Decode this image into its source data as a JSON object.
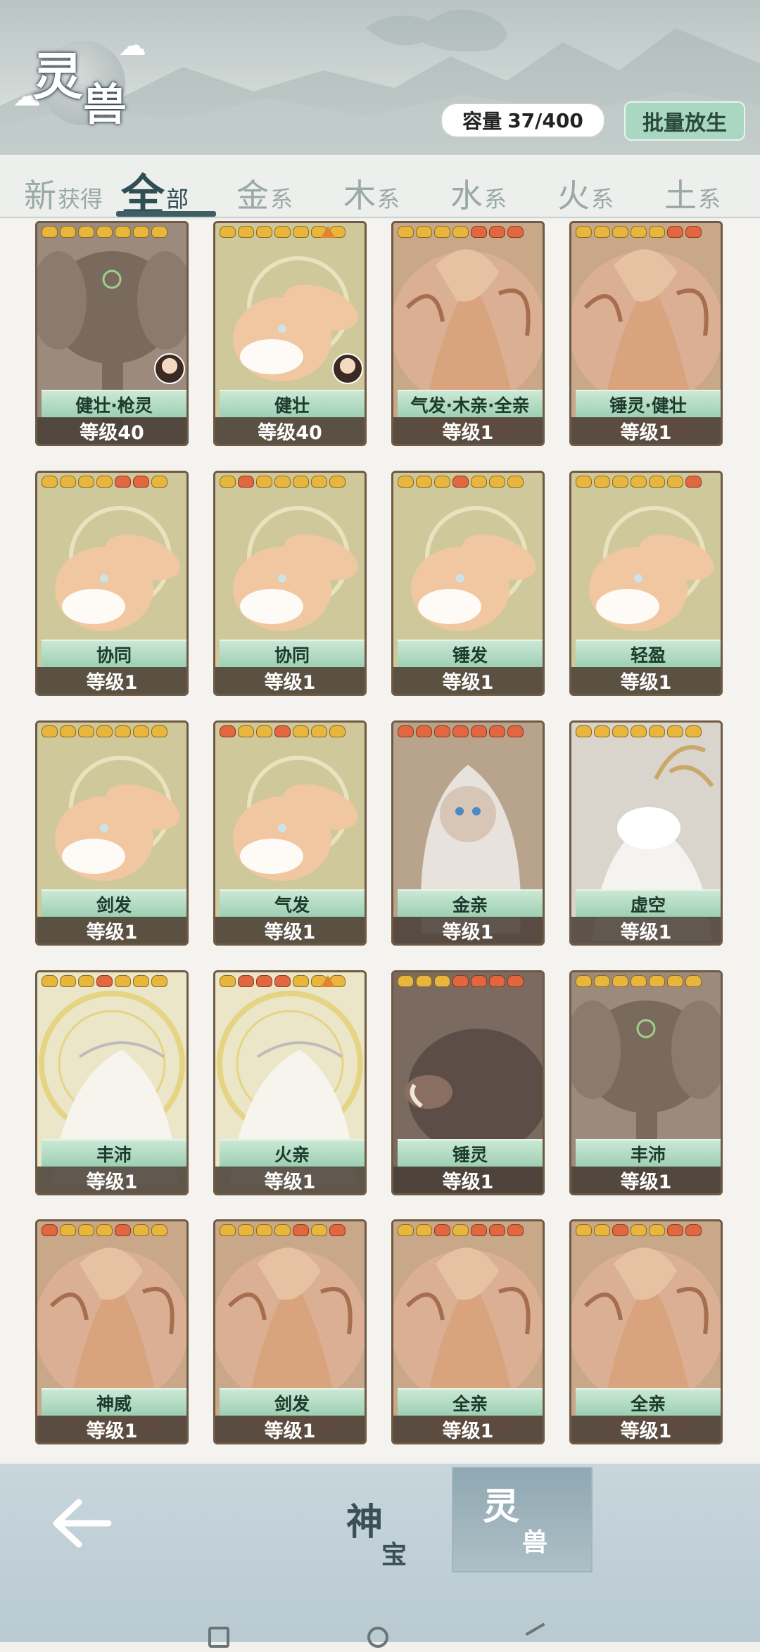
{
  "header": {
    "title_char1": "灵",
    "title_char2": "兽",
    "capacity_label": "容量",
    "capacity_value": "37/400",
    "batch_release_label": "批量放生"
  },
  "tabs": [
    {
      "big": "新",
      "small": "获得",
      "active": false
    },
    {
      "big": "全",
      "small": "部",
      "active": true
    },
    {
      "big": "金",
      "small": "系",
      "active": false
    },
    {
      "big": "木",
      "small": "系",
      "active": false
    },
    {
      "big": "水",
      "small": "系",
      "active": false
    },
    {
      "big": "火",
      "small": "系",
      "active": false
    },
    {
      "big": "土",
      "small": "系",
      "active": false
    }
  ],
  "cards": [
    {
      "name": "健壮·枪灵",
      "level": "等级40",
      "beast": "elephant",
      "stars": [
        "y",
        "y",
        "y",
        "y",
        "y",
        "y",
        "y"
      ],
      "warning": false,
      "avatar": true
    },
    {
      "name": "健壮",
      "level": "等级40",
      "beast": "rabbit",
      "stars": [
        "y",
        "y",
        "y",
        "y",
        "y",
        "y",
        "y"
      ],
      "warning": true,
      "avatar": true
    },
    {
      "name": "气发·木亲·全亲",
      "level": "等级1",
      "beast": "dragon",
      "stars": [
        "y",
        "y",
        "y",
        "y",
        "r",
        "r",
        "r"
      ],
      "warning": false,
      "avatar": false
    },
    {
      "name": "锤灵·健壮",
      "level": "等级1",
      "beast": "dragon",
      "stars": [
        "y",
        "y",
        "y",
        "y",
        "y",
        "r",
        "r"
      ],
      "warning": false,
      "avatar": false
    },
    {
      "name": "协同",
      "level": "等级1",
      "beast": "rabbit",
      "stars": [
        "y",
        "y",
        "y",
        "y",
        "r",
        "r",
        "y"
      ],
      "warning": false,
      "avatar": false
    },
    {
      "name": "协同",
      "level": "等级1",
      "beast": "rabbit",
      "stars": [
        "y",
        "r",
        "y",
        "y",
        "y",
        "y",
        "y"
      ],
      "warning": false,
      "avatar": false
    },
    {
      "name": "锤发",
      "level": "等级1",
      "beast": "rabbit",
      "stars": [
        "y",
        "y",
        "y",
        "r",
        "y",
        "y",
        "y"
      ],
      "warning": false,
      "avatar": false
    },
    {
      "name": "轻盈",
      "level": "等级1",
      "beast": "rabbit",
      "stars": [
        "y",
        "y",
        "y",
        "y",
        "y",
        "y",
        "r"
      ],
      "warning": false,
      "avatar": false
    },
    {
      "name": "剑发",
      "level": "等级1",
      "beast": "rabbit",
      "stars": [
        "y",
        "y",
        "y",
        "y",
        "y",
        "y",
        "y"
      ],
      "warning": false,
      "avatar": false
    },
    {
      "name": "气发",
      "level": "等级1",
      "beast": "rabbit",
      "stars": [
        "r",
        "y",
        "y",
        "r",
        "y",
        "y",
        "y"
      ],
      "warning": false,
      "avatar": false
    },
    {
      "name": "金亲",
      "level": "等级1",
      "beast": "monkey",
      "stars": [
        "r",
        "r",
        "r",
        "r",
        "r",
        "r",
        "r"
      ],
      "warning": false,
      "avatar": false
    },
    {
      "name": "虚空",
      "level": "等级1",
      "beast": "qilin",
      "stars": [
        "y",
        "y",
        "y",
        "y",
        "y",
        "y",
        "y"
      ],
      "warning": false,
      "avatar": false
    },
    {
      "name": "丰沛",
      "level": "等级1",
      "beast": "white",
      "stars": [
        "y",
        "y",
        "y",
        "r",
        "y",
        "y",
        "y"
      ],
      "warning": false,
      "avatar": false
    },
    {
      "name": "火亲",
      "level": "等级1",
      "beast": "white",
      "stars": [
        "y",
        "r",
        "r",
        "r",
        "y",
        "y",
        "y"
      ],
      "warning": true,
      "avatar": false
    },
    {
      "name": "锤灵",
      "level": "等级1",
      "beast": "boar",
      "stars": [
        "y",
        "y",
        "y",
        "r",
        "r",
        "r",
        "r"
      ],
      "warning": false,
      "avatar": false
    },
    {
      "name": "丰沛",
      "level": "等级1",
      "beast": "elephant",
      "stars": [
        "y",
        "y",
        "y",
        "y",
        "y",
        "y",
        "y"
      ],
      "warning": false,
      "avatar": false
    },
    {
      "name": "神威",
      "level": "等级1",
      "beast": "dragon",
      "stars": [
        "r",
        "y",
        "y",
        "y",
        "r",
        "y",
        "y"
      ],
      "warning": false,
      "avatar": false
    },
    {
      "name": "剑发",
      "level": "等级1",
      "beast": "dragon",
      "stars": [
        "y",
        "y",
        "y",
        "y",
        "r",
        "y",
        "r"
      ],
      "warning": false,
      "avatar": false
    },
    {
      "name": "全亲",
      "level": "等级1",
      "beast": "dragon",
      "stars": [
        "y",
        "y",
        "r",
        "y",
        "r",
        "r",
        "r"
      ],
      "warning": false,
      "avatar": false
    },
    {
      "name": "全亲",
      "level": "等级1",
      "beast": "dragon",
      "stars": [
        "y",
        "y",
        "r",
        "y",
        "y",
        "r",
        "r"
      ],
      "warning": false,
      "avatar": false
    }
  ],
  "bottom_nav": {
    "shenbao_big": "神",
    "shenbao_small": "宝",
    "lingshou_big": "灵",
    "lingshou_small": "兽"
  },
  "colors": {
    "accent_green": "#a9d7c1",
    "tab_active": "#2f4f55",
    "star_yellow": "#e8b63c",
    "star_red": "#e0673f"
  }
}
